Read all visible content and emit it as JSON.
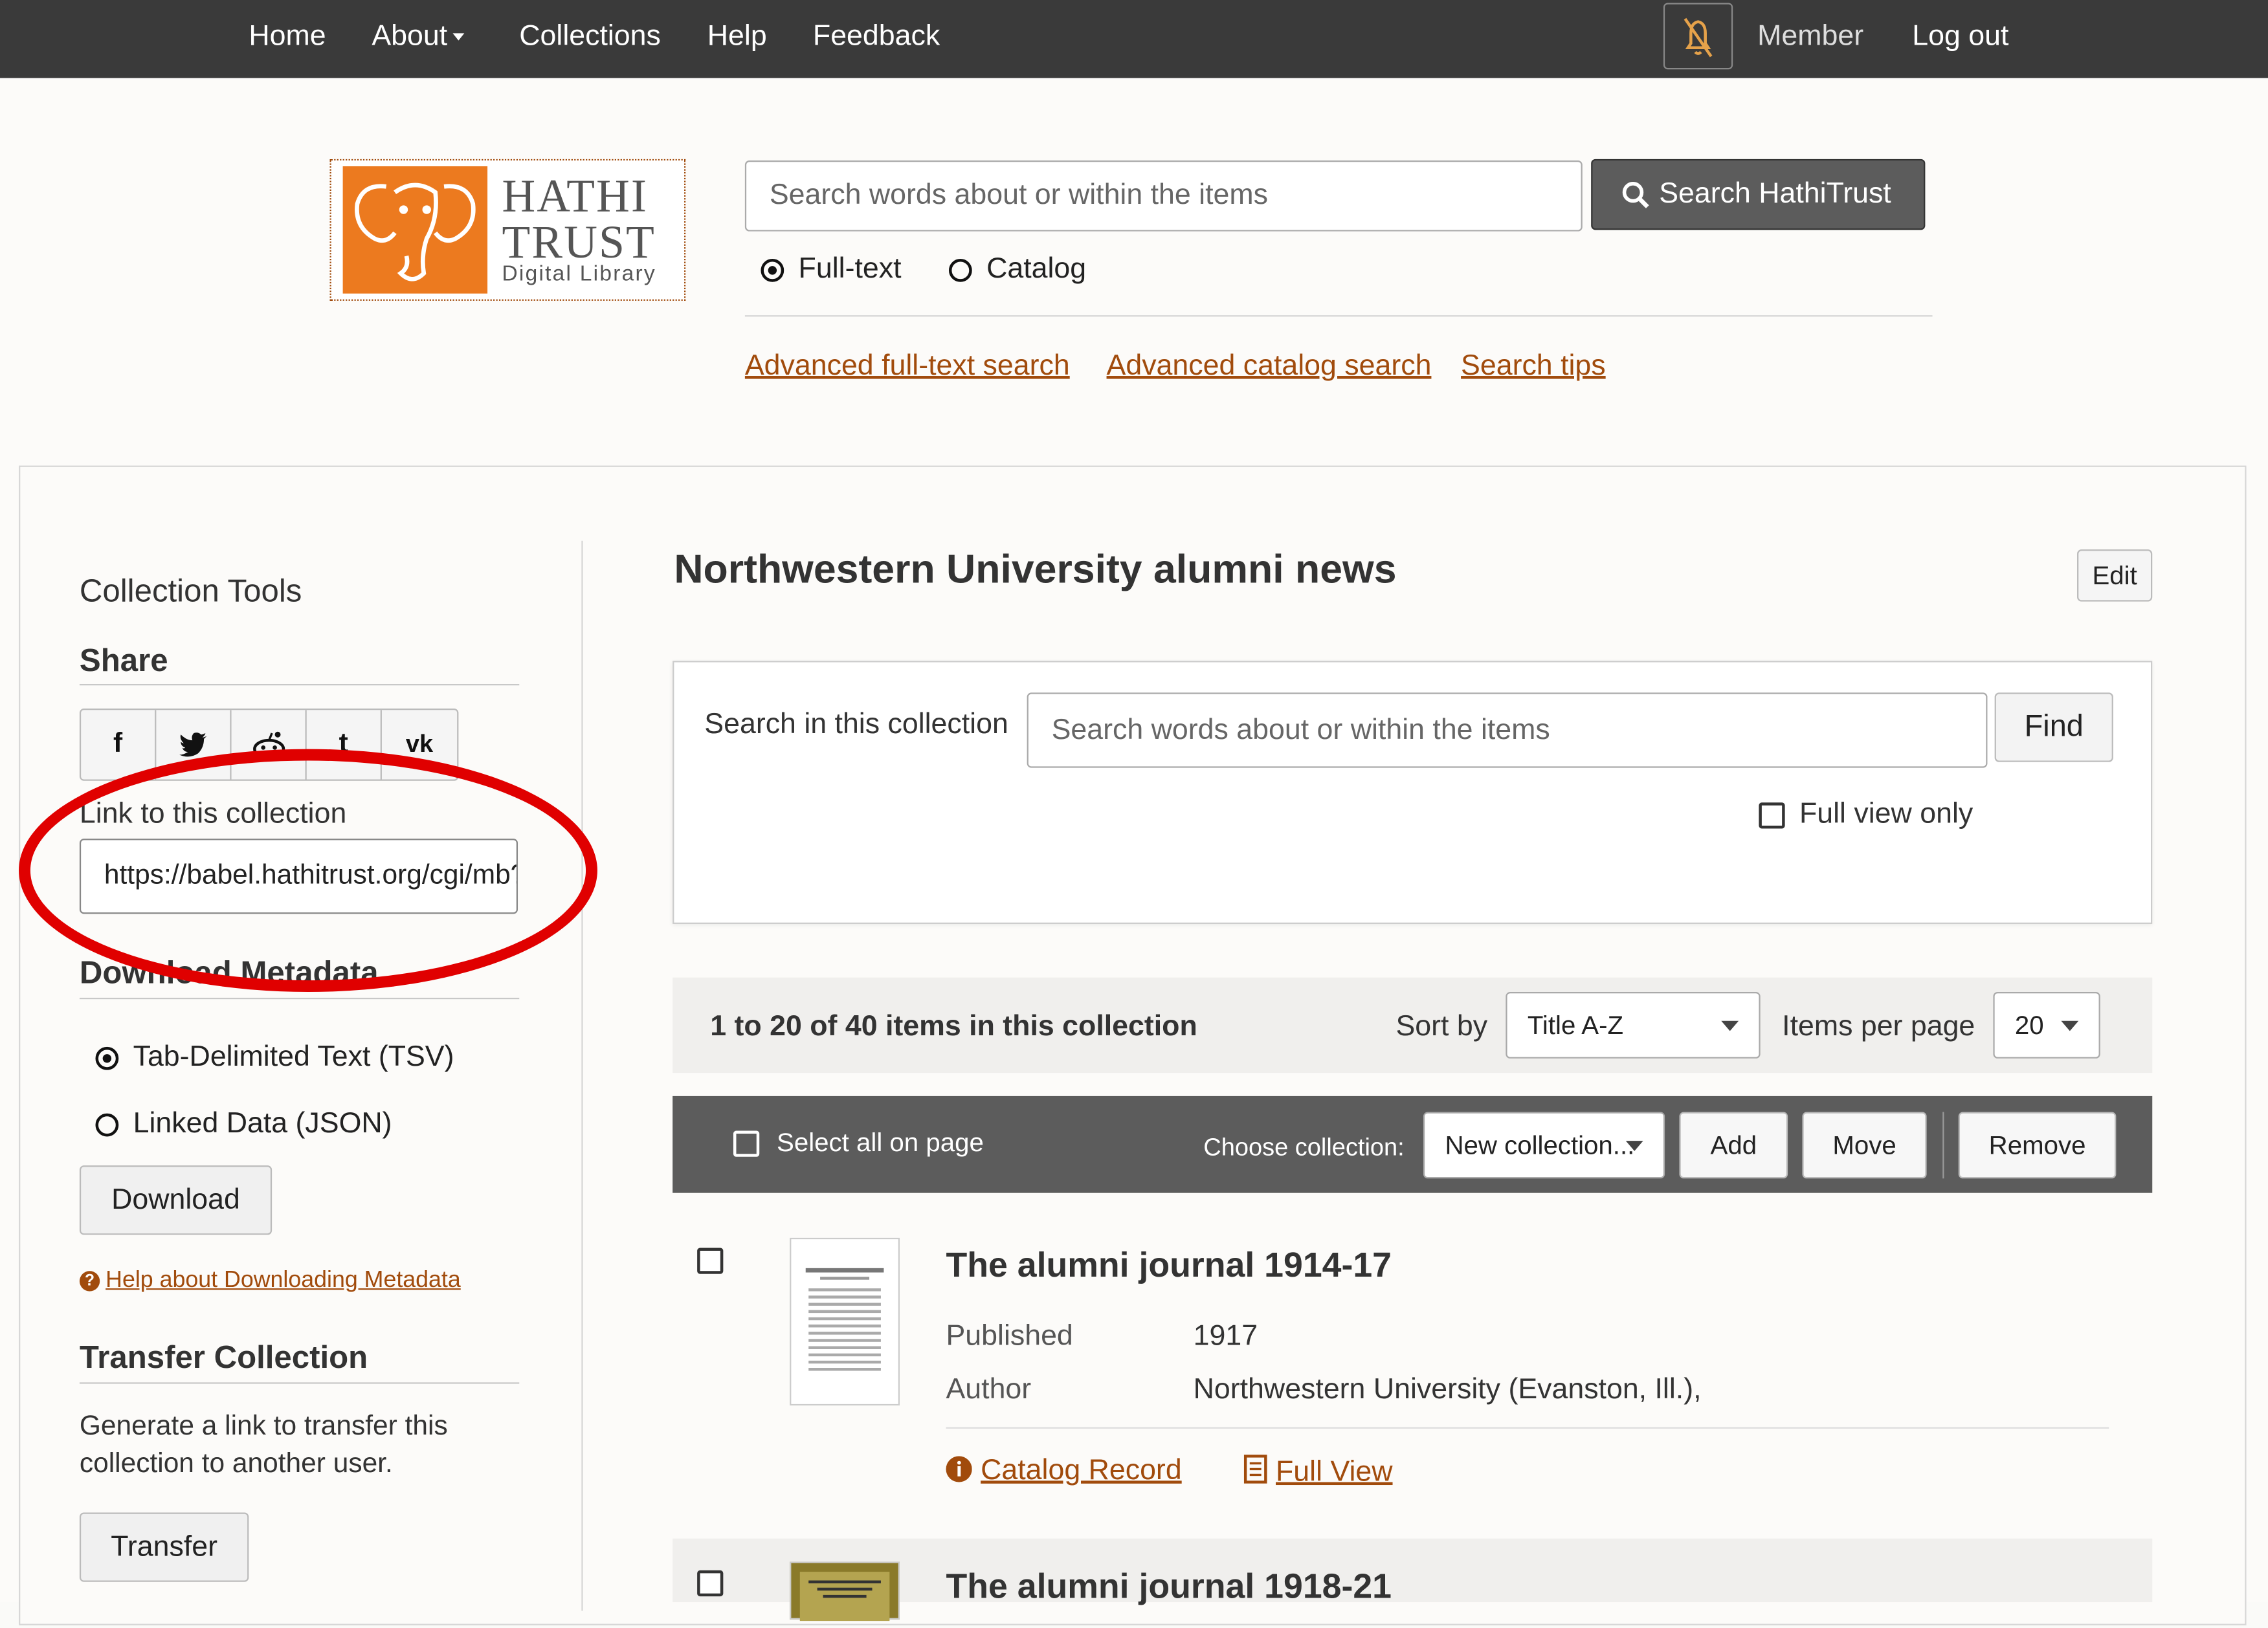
{
  "nav": {
    "home": "Home",
    "about": "About",
    "collections": "Collections",
    "help": "Help",
    "feedback": "Feedback",
    "member": "Member",
    "logout": "Log out"
  },
  "logo": {
    "line1": "HATHI",
    "line2": "TRUST",
    "line3": "Digital Library"
  },
  "search": {
    "placeholder": "Search words about or within the items",
    "button": "Search HathiTrust",
    "options": [
      "Full-text",
      "Catalog"
    ],
    "selected": "Full-text",
    "links": [
      "Advanced full-text search",
      "Advanced catalog search",
      "Search tips"
    ]
  },
  "sidebar": {
    "title": "Collection Tools",
    "share_heading": "Share",
    "share_buttons": [
      "f",
      "t",
      "r",
      "t",
      "vk"
    ],
    "link_label": "Link to this collection",
    "link_value": "https://babel.hathitrust.org/cgi/mb?a=listis;c=",
    "download_heading": "Download Metadata",
    "download_options": [
      "Tab-Delimited Text (TSV)",
      "Linked Data (JSON)"
    ],
    "download_selected": "Tab-Delimited Text (TSV)",
    "download_button": "Download",
    "help_link": "Help about Downloading Metadata",
    "transfer_heading": "Transfer Collection",
    "transfer_text": "Generate a link to transfer this collection to another user.",
    "transfer_button": "Transfer"
  },
  "main": {
    "title": "Northwestern University alumni news",
    "edit": "Edit",
    "search_label": "Search in this collection",
    "search_placeholder": "Search words about or within the items",
    "find": "Find",
    "full_view_only": "Full view only",
    "count": "1 to 20 of 40 items in this collection",
    "sort_label": "Sort by",
    "sort_value": "Title A-Z",
    "ipp_label": "Items per page",
    "ipp_value": "20",
    "select_all": "Select all on page",
    "choose_collection": "Choose collection:",
    "collection_value": "New collection...",
    "add": "Add",
    "move": "Move",
    "remove": "Remove",
    "items": [
      {
        "title": "The alumni journal 1914-17",
        "published_label": "Published",
        "published": "1917",
        "author_label": "Author",
        "author": "Northwestern University (Evanston, Ill.),",
        "catalog_link": "Catalog Record",
        "full_view_link": "Full View"
      },
      {
        "title": "The alumni journal 1918-21"
      }
    ]
  },
  "colors": {
    "nav_bg": "#3a3a3a",
    "accent": "#a14b0c",
    "logo_orange": "#ec7a1f",
    "annotation": "#e00000"
  }
}
